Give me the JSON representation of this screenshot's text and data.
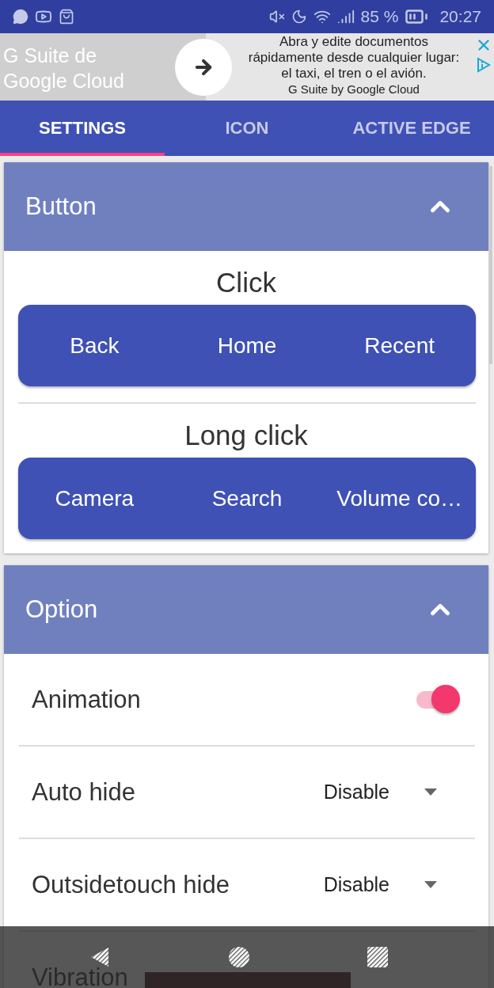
{
  "status_bar": {
    "battery": "85 %",
    "time": "20:27"
  },
  "ad": {
    "headline": "G Suite de Google Cloud",
    "lines": [
      "Abra y edite documentos",
      "rápidamente desde cualquier lugar:",
      "el taxi, el tren o el avión."
    ],
    "advertiser": "G Suite by Google Cloud"
  },
  "tabs": [
    {
      "label": "SETTINGS",
      "selected": true
    },
    {
      "label": "ICON",
      "selected": false
    },
    {
      "label": "ACTIVE EDGE",
      "selected": false
    }
  ],
  "sections": [
    {
      "title": "Button",
      "expanded": true,
      "kind": "buttons",
      "groups": [
        {
          "title": "Click",
          "buttons": [
            "Back",
            "Home",
            "Recent"
          ]
        },
        {
          "title": "Long click",
          "buttons": [
            "Camera",
            "Search",
            "Volume co…"
          ]
        }
      ]
    },
    {
      "title": "Option",
      "expanded": true,
      "kind": "options",
      "rows": [
        {
          "kind": "switch",
          "label": "Animation",
          "on": true
        },
        {
          "kind": "dropdown",
          "label": "Auto hide",
          "value": "Disable"
        },
        {
          "kind": "dropdown",
          "label": "Outsidetouch hide",
          "value": "Disable"
        },
        {
          "kind": "plain",
          "label": "Vibration"
        }
      ]
    }
  ]
}
